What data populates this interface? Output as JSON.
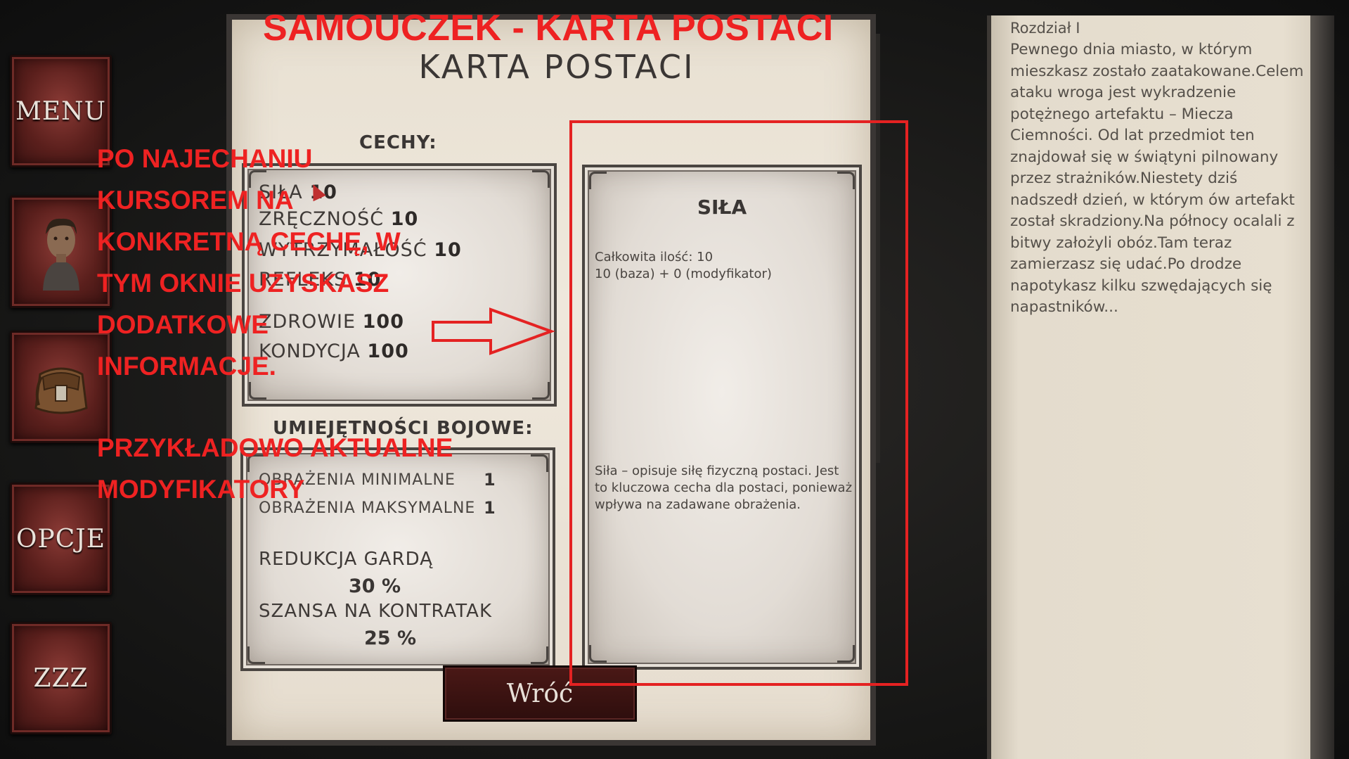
{
  "sidebar": {
    "menu_label": "MENU",
    "opcje_label": "OPCJE",
    "zzz_label": "ZZZ",
    "hero_icon": "character-portrait",
    "bag_icon": "backpack-icon"
  },
  "character_sheet": {
    "title": "KARTA POSTACI",
    "traits_heading": "CECHY:",
    "traits": [
      {
        "name": "SIŁA",
        "value": "10"
      },
      {
        "name": "ZRĘCZNOŚĆ",
        "value": "10"
      },
      {
        "name": "WYTRZYMAŁOŚĆ",
        "value": "10"
      },
      {
        "name": "REFLEKS",
        "value": "10"
      },
      {
        "name": "ZDROWIE",
        "value": "100"
      },
      {
        "name": "KONDYCJA",
        "value": "100"
      }
    ],
    "combat_heading": "UMIEJĘTNOŚCI BOJOWE:",
    "combat": {
      "min_damage_label": "OBRAŻENIA MINIMALNE",
      "min_damage_value": "1",
      "max_damage_label": "OBRAŻENIA MAKSYMALNE",
      "max_damage_value": "1",
      "guard_label": "REDUKCJA GARDĄ",
      "guard_value": "30 %",
      "counter_label": "SZANSA NA KONTRATAK",
      "counter_value": "25 %"
    },
    "back_label": "Wróć"
  },
  "detail": {
    "title": "SIŁA",
    "total_line": "Całkowita ilość:  10",
    "breakdown_line": "10  (baza) +  0 (modyfikator)",
    "description": "Siła – opisuje siłę fizyczną postaci. Jest to kluczowa cecha dla postaci, ponieważ wpływa na zadawane obrażenia."
  },
  "story": {
    "chapter": "Rozdział I",
    "text": "Pewnego dnia miasto, w którym mieszkasz zostało zaatakowane.Celem ataku wroga jest wykradzenie potężnego artefaktu – Miecza Ciemności. Od lat przedmiot ten znajdował się w świątyni pilnowany przez strażników.Niestety dziś nadszedł dzień, w którym ów artefakt został skradziony.Na północy ocalali z bitwy założyli obóz.Tam teraz zamierzasz się udać.Po drodze napotykasz kilku szwędających się napastników..."
  },
  "tutorial": {
    "title": "SAMOUCZEK - KARTA POSTACI",
    "lines": [
      "PO NAJECHANIU",
      "KURSOREM NA",
      "KONKRETNĄ CECHĘ, W",
      "TYM OKNIE UZYSKASZ",
      "DODATKOWE",
      "INFORMACJE."
    ],
    "lines2": [
      "PRZYKŁADOWO AKTUALNE",
      "MODYFIKATORY"
    ],
    "accent": "#ee2222"
  }
}
